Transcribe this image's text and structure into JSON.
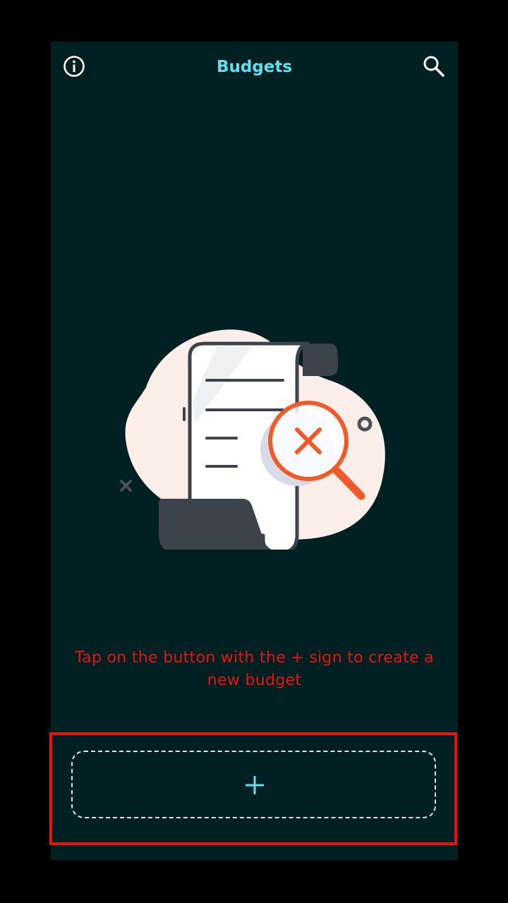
{
  "header": {
    "title": "Budgets",
    "left_icon": "info-icon",
    "right_icon": "search-icon"
  },
  "empty_state": {
    "illustration": "document-not-found-illustration",
    "hint": "Tap on the button with the + sign to create a new budget"
  },
  "add_button": {
    "icon": "plus-icon"
  },
  "colors": {
    "background": "#012022",
    "accent": "#5ee1ee",
    "hint_text": "#e8140e",
    "highlight": "#ee0f0f",
    "illustration_orange": "#f05a28"
  }
}
